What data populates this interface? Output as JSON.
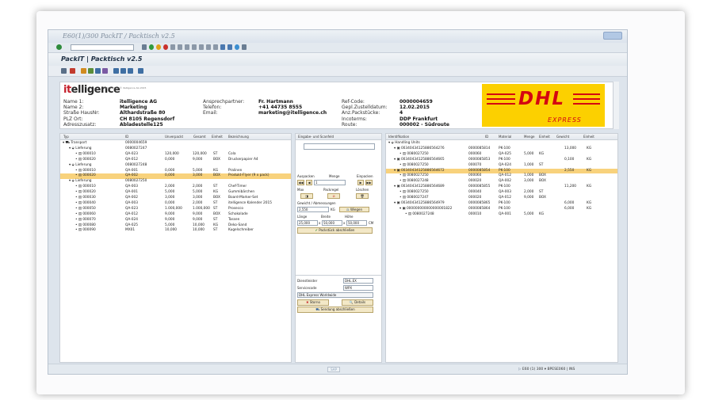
{
  "window": {
    "title": "E60(1)/300 PackIT / Packtisch v2.5"
  },
  "app": {
    "title": "PackIT | Packtisch v2.5"
  },
  "logo": {
    "text_it": "it",
    "text_rest": "elligence",
    "subtitle": "PackIT v2.5 | © itelligence AG 2015"
  },
  "header": {
    "left_labels": [
      "Name 1:",
      "Name 2:",
      "Straße HausNr:",
      "PLZ Ort:",
      "Adresszusatz:"
    ],
    "left_values": [
      "itelligence AG",
      "Marketing",
      "Althardstraße 80",
      "CH 8105 Regensdorf",
      "Abladestelle125"
    ],
    "mid_labels": [
      "Ansprechpartner:",
      "Telefon:",
      "Email:"
    ],
    "mid_values": [
      "Fr. Hartmann",
      "+41 44735 8555",
      "marketing@itelligence.ch"
    ],
    "right_labels": [
      "Ref-Code:",
      "Gepl.Zustelldatum:",
      "Anz.Packstücke:",
      "Incoterms:",
      "Route:"
    ],
    "right_values": [
      "0000004659",
      "12.02.2015",
      "4",
      "DDP Frankfurt",
      "000002 - Südroute"
    ]
  },
  "carrier_logo": {
    "brand": "DHL",
    "tag": "EXPRESS"
  },
  "left_table": {
    "headers": [
      "Typ",
      "ID",
      "Unverpackt",
      "Gesamt",
      "Einheit",
      "Bezeichnung"
    ],
    "rows": [
      {
        "typ": "Transport",
        "id": "0000004659",
        "unv": "",
        "ges": "",
        "ein": "",
        "bez": "",
        "indent": 0,
        "style": ""
      },
      {
        "typ": "Lieferung",
        "id": "0080027247",
        "unv": "",
        "ges": "",
        "ein": "",
        "bez": "",
        "indent": 1,
        "style": ""
      },
      {
        "typ": "000010",
        "id": "QA-023",
        "unv": "120,000",
        "ges": "120,000",
        "ein": "ST",
        "bez": "Cola",
        "indent": 2,
        "style": ""
      },
      {
        "typ": "000020",
        "id": "QA-012",
        "unv": "0,000",
        "ges": "9,000",
        "ein": "BOX",
        "bez": "Druckerpapier A4",
        "indent": 2,
        "style": ""
      },
      {
        "typ": "Lieferung",
        "id": "0080027248",
        "unv": "",
        "ges": "",
        "ein": "",
        "bez": "",
        "indent": 1,
        "style": ""
      },
      {
        "typ": "000010",
        "id": "QA-001",
        "unv": "0,000",
        "ges": "5,000",
        "ein": "KG",
        "bez": "Pralinen",
        "indent": 2,
        "style": ""
      },
      {
        "typ": "000020",
        "id": "QA-002",
        "unv": "0,000",
        "ges": "3,000",
        "ein": "BOX",
        "bez": "Produkt-Flyer (9 x pack)",
        "indent": 2,
        "style": "sel2"
      },
      {
        "typ": "Lieferung",
        "id": "0080027250",
        "unv": "",
        "ges": "",
        "ein": "",
        "bez": "",
        "indent": 1,
        "style": ""
      },
      {
        "typ": "000010",
        "id": "QA-003",
        "unv": "2,000",
        "ges": "2,000",
        "ein": "ST",
        "bez": "Chef-Timer",
        "indent": 2,
        "style": ""
      },
      {
        "typ": "000020",
        "id": "QA-001",
        "unv": "5,000",
        "ges": "5,000",
        "ein": "KG",
        "bez": "Gummibärchen",
        "indent": 2,
        "style": ""
      },
      {
        "typ": "000030",
        "id": "QA-002",
        "unv": "3,000",
        "ges": "3,000",
        "ein": "BOX",
        "bez": "Board-Marker-Set",
        "indent": 2,
        "style": ""
      },
      {
        "typ": "000040",
        "id": "QA-003",
        "unv": "0,000",
        "ges": "2,000",
        "ein": "ST",
        "bez": "itelligence Kalender 2015",
        "indent": 2,
        "style": ""
      },
      {
        "typ": "000050",
        "id": "QA-023",
        "unv": "1.000,000",
        "ges": "1.000,000",
        "ein": "ST",
        "bez": "Prosecco",
        "indent": 2,
        "style": ""
      },
      {
        "typ": "000060",
        "id": "QA-012",
        "unv": "9,000",
        "ges": "9,000",
        "ein": "BOX",
        "bez": "Schokolade",
        "indent": 2,
        "style": ""
      },
      {
        "typ": "000070",
        "id": "QA-024",
        "unv": "9,000",
        "ges": "9,000",
        "ein": "ST",
        "bez": "Tassen",
        "indent": 2,
        "style": ""
      },
      {
        "typ": "000080",
        "id": "QA-025",
        "unv": "5,000",
        "ges": "10,000",
        "ein": "KG",
        "bez": "Deko-Sand",
        "indent": 2,
        "style": ""
      },
      {
        "typ": "000090",
        "id": "MX01",
        "unv": "10,000",
        "ges": "10,000",
        "ein": "ST",
        "bez": "Kugelschreiber",
        "indent": 2,
        "style": ""
      }
    ]
  },
  "mid": {
    "scan_header": "Eingabe- und Scanfeld",
    "scan_value": "",
    "lbl_auspacken": "Auspacken",
    "lbl_menge": "Menge",
    "lbl_einpacken": "Einpacken",
    "menge_value": "1",
    "lbl_max": "Max",
    "lbl_packregel": "Packregel",
    "lbl_loeschen": "Löschen",
    "lbl_gewicht": "Gewicht / Abmessungen",
    "gewicht_value": "2,550",
    "gewicht_unit": "KG",
    "btn_wiegen": "Wiegen",
    "lbl_laenge": "Länge",
    "lbl_breite": "Breite",
    "lbl_hoehe": "Höhe",
    "laenge_value": "25,000",
    "breite_value": "50,000",
    "hoehe_value": "50,000",
    "dim_unit": "CM",
    "btn_packstueck": "Packstück abschließen",
    "lbl_dienstleister": "Dienstleister",
    "dienstleister_value": "DHL.EX",
    "lbl_servicecode": "Servicecode",
    "servicecode_value": "WPX",
    "service_desc": "DHL Express Worldwide",
    "btn_storno": "Storno",
    "btn_details": "Details",
    "btn_sendung": "Sendung abschließen"
  },
  "right_table": {
    "headers": [
      "Identifikation",
      "ID",
      "Material",
      "Menge",
      "Einheit",
      "Gewicht",
      "Einheit"
    ],
    "rows": [
      {
        "ident": "Handling Units",
        "id": "",
        "mat": "",
        "menge": "",
        "ein": "",
        "gew": "",
        "gein": "",
        "indent": 0,
        "style": ""
      },
      {
        "ident": "00340434125886564276",
        "id": "0000085814",
        "mat": "PK-100",
        "menge": "",
        "ein": "",
        "gew": "13,000",
        "gein": "KG",
        "indent": 1,
        "style": ""
      },
      {
        "ident": "0080027250",
        "id": "000060",
        "mat": "QA-025",
        "menge": "5,000",
        "ein": "KG",
        "gew": "",
        "gein": "",
        "indent": 2,
        "style": ""
      },
      {
        "ident": "00340434125886564665",
        "id": "0000085853",
        "mat": "PK-100",
        "menge": "",
        "ein": "",
        "gew": "0,100",
        "gein": "KG",
        "indent": 1,
        "style": ""
      },
      {
        "ident": "0080027250",
        "id": "000070",
        "mat": "QA-024",
        "menge": "1,000",
        "ein": "ST",
        "gew": "",
        "gein": "",
        "indent": 2,
        "style": ""
      },
      {
        "ident": "00340434125886564672",
        "id": "0000085854",
        "mat": "PK-100",
        "menge": "",
        "ein": "",
        "gew": "2,550",
        "gein": "KG",
        "indent": 1,
        "style": "sel2"
      },
      {
        "ident": "0080027250",
        "id": "000060",
        "mat": "QA-012",
        "menge": "1,000",
        "ein": "BOX",
        "gew": "",
        "gein": "",
        "indent": 2,
        "style": ""
      },
      {
        "ident": "0080027248",
        "id": "000020",
        "mat": "QA-002",
        "menge": "3,000",
        "ein": "BOX",
        "gew": "",
        "gein": "",
        "indent": 2,
        "style": ""
      },
      {
        "ident": "00340434125886564689",
        "id": "0000085855",
        "mat": "PK-100",
        "menge": "",
        "ein": "",
        "gew": "11,200",
        "gein": "KG",
        "indent": 1,
        "style": ""
      },
      {
        "ident": "0080027250",
        "id": "000040",
        "mat": "QA-003",
        "menge": "2,000",
        "ein": "ST",
        "gew": "",
        "gein": "",
        "indent": 2,
        "style": ""
      },
      {
        "ident": "0080027247",
        "id": "000020",
        "mat": "QA-012",
        "menge": "9,000",
        "ein": "BOX",
        "gew": "",
        "gein": "",
        "indent": 2,
        "style": ""
      },
      {
        "ident": "00340434125886564979",
        "id": "0000085865",
        "mat": "PK-100",
        "menge": "",
        "ein": "",
        "gew": "6,000",
        "gein": "KG",
        "indent": 1,
        "style": ""
      },
      {
        "ident": "000000000000000001822",
        "id": "0000085864",
        "mat": "PK-100",
        "menge": "",
        "ein": "",
        "gew": "6,000",
        "gein": "KG",
        "indent": 2,
        "style": ""
      },
      {
        "ident": "0080027248",
        "id": "000010",
        "mat": "QA-001",
        "menge": "5,000",
        "ein": "KG",
        "gew": "",
        "gein": "",
        "indent": 3,
        "style": ""
      }
    ]
  },
  "status": {
    "sap_text": "SAP",
    "session": "E60 (1) 300",
    "server": "BPESE060",
    "mode": "INS"
  }
}
